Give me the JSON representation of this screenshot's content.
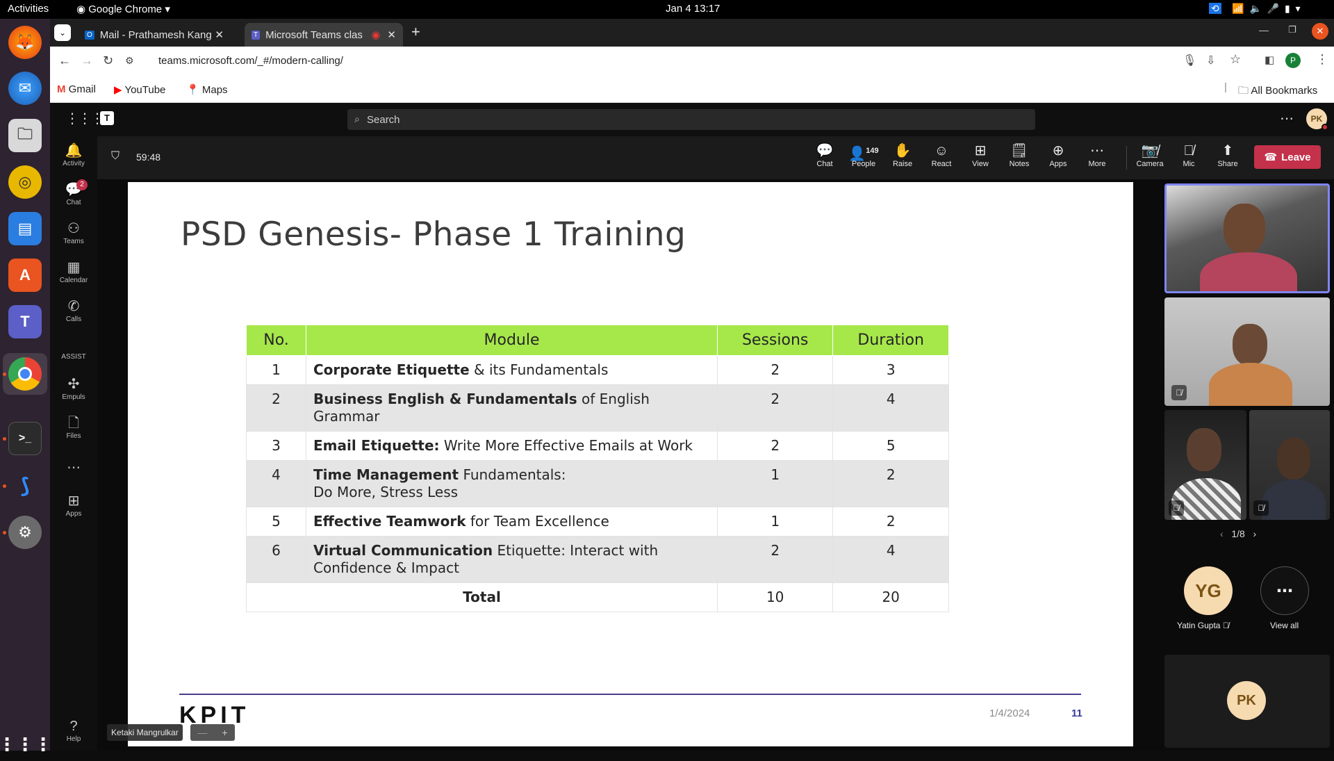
{
  "os": {
    "activities": "Activities",
    "app_menu": "Google Chrome",
    "datetime": "Jan 4  13:17"
  },
  "browser": {
    "tabs": [
      {
        "label": "Mail - Prathamesh Kanga"
      },
      {
        "label": "Microsoft Teams clas"
      }
    ],
    "url": "teams.microsoft.com/_#/modern-calling/",
    "profile_initial": "P",
    "bookmarks": [
      "Gmail",
      "YouTube",
      "Maps"
    ],
    "all_bookmarks": "All Bookmarks"
  },
  "teams": {
    "search_placeholder": "Search",
    "user_initials": "PK",
    "rail": [
      {
        "label": "Activity",
        "icon": "bell-icon"
      },
      {
        "label": "Chat",
        "icon": "chat-icon",
        "badge": "2"
      },
      {
        "label": "Teams",
        "icon": "teams-icon"
      },
      {
        "label": "Calendar",
        "icon": "calendar-icon"
      },
      {
        "label": "Calls",
        "icon": "phone-icon"
      },
      {
        "label": "ASSIST",
        "icon": ""
      },
      {
        "label": "Empuls",
        "icon": "empuls-icon"
      },
      {
        "label": "Files",
        "icon": "file-icon"
      },
      {
        "label": "Apps",
        "icon": "apps-icon"
      },
      {
        "label": "Help",
        "icon": "help-icon"
      }
    ],
    "meeting": {
      "timer": "59:48",
      "people_count": "149",
      "controls": [
        {
          "label": "Chat"
        },
        {
          "label": "People"
        },
        {
          "label": "Raise"
        },
        {
          "label": "React"
        },
        {
          "label": "View"
        },
        {
          "label": "Notes"
        },
        {
          "label": "Apps"
        },
        {
          "label": "More"
        },
        {
          "label": "Camera"
        },
        {
          "label": "Mic"
        },
        {
          "label": "Share"
        }
      ],
      "leave_label": "Leave",
      "presenter_name": "Ketaki Mangrulkar"
    },
    "participants": {
      "pager": "1/8",
      "named": [
        {
          "initials": "YG",
          "name": "Yatin Gupta"
        }
      ],
      "view_all": "View all",
      "self_initials": "PK"
    }
  },
  "slide": {
    "title": "PSD Genesis- Phase 1 Training",
    "headers": [
      "No.",
      "Module",
      "Sessions",
      "Duration"
    ],
    "rows": [
      {
        "no": "1",
        "bold": "Corporate Etiquette",
        "rest": " & its Fundamentals",
        "sessions": "2",
        "duration": "3"
      },
      {
        "no": "2",
        "bold": "Business English & Fundamentals",
        "rest": " of English Grammar",
        "sessions": "2",
        "duration": "4"
      },
      {
        "no": "3",
        "bold": "Email Etiquette:",
        "rest": " Write More Effective Emails at Work",
        "sessions": "2",
        "duration": "5"
      },
      {
        "no": "4",
        "bold": "Time Management",
        "rest": " Fundamentals: Do More, Stress Less",
        "sessions": "1",
        "duration": "2"
      },
      {
        "no": "5",
        "bold": "Effective Teamwork",
        "rest": " for Team Excellence",
        "sessions": "1",
        "duration": "2"
      },
      {
        "no": "6",
        "bold": "Virtual Communication",
        "rest": " Etiquette: Interact with Confidence & Impact",
        "sessions": "2",
        "duration": "4"
      }
    ],
    "total_label": "Total",
    "total_sessions": "10",
    "total_duration": "20",
    "logo": "KPIT",
    "date": "1/4/2024",
    "page": "11"
  }
}
